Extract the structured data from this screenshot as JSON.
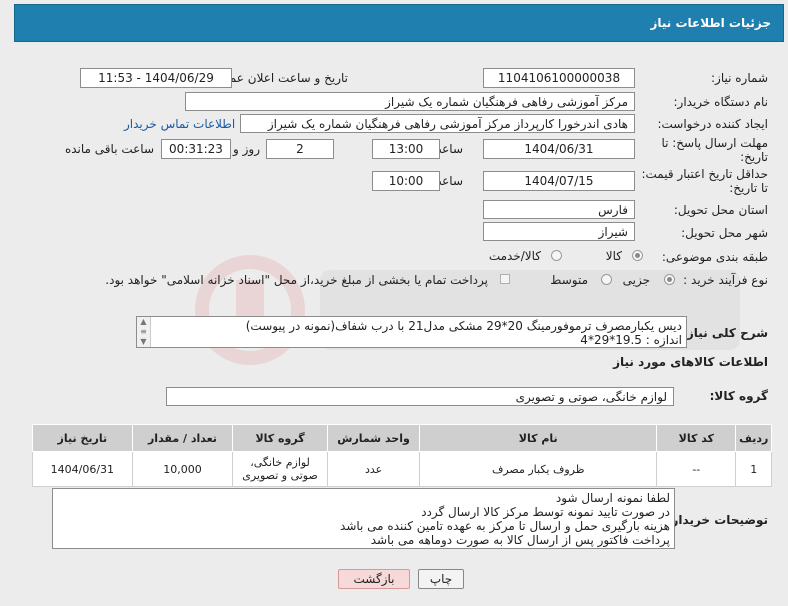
{
  "header": {
    "title": "جزئیات اطلاعات نیاز"
  },
  "form": {
    "need_number_label": "شماره نیاز:",
    "need_number": "1104106100000038",
    "announce_label": "تاریخ و ساعت اعلان عمومی:",
    "announce_value": "1404/06/29 - 11:53",
    "buyer_org_label": "نام دستگاه خریدار:",
    "buyer_org": "مرکز آموزشی رفاهی فرهنگیان شماره یک شیراز",
    "creator_label": "ایجاد کننده درخواست:",
    "creator": "هادی اندرخورا کارپرداز مرکز آموزشی رفاهی فرهنگیان شماره یک شیراز",
    "contact_link": "اطلاعات تماس خریدار",
    "deadline_label_1": "مهلت ارسال پاسخ: تا",
    "deadline_label_2": "تاریخ:",
    "deadline_date": "1404/06/31",
    "time_label": "ساعت",
    "deadline_time": "13:00",
    "days_value": "2",
    "days_label": "روز و",
    "remaining_time": "00:31:23",
    "remaining_label": "ساعت باقی مانده",
    "min_validity_label_1": "حداقل تاریخ اعتبار قیمت:",
    "min_validity_label_2": "تا تاریخ:",
    "validity_date": "1404/07/15",
    "validity_time": "10:00",
    "province_label": "استان محل تحویل:",
    "province": "فارس",
    "city_label": "شهر محل تحویل:",
    "city": "شیراز",
    "category_label": "طبقه بندی موضوعی:",
    "category_options": [
      "کالا",
      "کالا/خدمت"
    ],
    "process_label": "نوع فرآیند خرید :",
    "process_options": [
      "جزیی",
      "متوسط"
    ],
    "payment_note": "پرداخت تمام یا بخشی از مبلغ خرید،از محل \"اسناد خزانه اسلامی\" خواهد بود."
  },
  "description": {
    "label": "شرح کلی نیاز:",
    "line1": "دیس یکبارمصرف ترموفورمینگ 20*29 مشکی مدل21 با درب شفاف(نمونه در پیوست)",
    "line2": "اندازه : 19.5*29*4"
  },
  "goods": {
    "title": "اطلاعات کالاهای مورد نیاز",
    "group_label": "گروه کالا:",
    "group_value": "لوازم خانگی، صوتی و تصویری",
    "columns": [
      "ردیف",
      "کد کالا",
      "نام کالا",
      "واحد شمارش",
      "گروه کالا",
      "تعداد / مقدار",
      "تاریخ نیاز"
    ],
    "rows": [
      {
        "row": "1",
        "code": "--",
        "name": "ظروف یکبار مصرف",
        "unit": "عدد",
        "group_line1": "لوازم خانگی،",
        "group_line2": "صوتی و تصویری",
        "qty": "10,000",
        "date": "1404/06/31"
      }
    ]
  },
  "buyer_notes": {
    "label": "توضیحات خریدار:",
    "lines": [
      "لطفا نمونه ارسال شود",
      "در صورت تایید نمونه توسط مرکز کالا ارسال گردد",
      "هزینه بارگیری حمل و ارسال تا مرکز به عهده تامین کننده می باشد",
      "پرداخت فاکتور پس از ارسال کالا به صورت  دوماهه  می باشد"
    ]
  },
  "buttons": {
    "print": "چاپ",
    "back": "بازگشت"
  },
  "colors": {
    "header": "#1f7fae",
    "back_button": "#f7d9d9",
    "link": "#1a5aa8"
  }
}
